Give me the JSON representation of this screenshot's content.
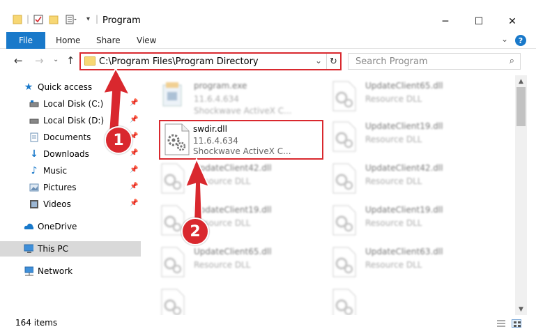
{
  "window": {
    "title": "Program",
    "minimize": "─",
    "maximize": "☐",
    "close": "✕"
  },
  "ribbon": {
    "tabs": [
      "File",
      "Home",
      "Share",
      "View"
    ],
    "help": "?"
  },
  "address": {
    "path": "C:\\Program Files\\Program Directory",
    "search_placeholder": "Search Program"
  },
  "sidebar": {
    "items": [
      {
        "label": "Quick access",
        "icon": "star-icon",
        "pinned": false
      },
      {
        "label": "Local Disk (C:)",
        "icon": "disk-icon",
        "pinned": true
      },
      {
        "label": "Local Disk (D:)",
        "icon": "disk-icon",
        "pinned": true
      },
      {
        "label": "Documents",
        "icon": "documents-icon",
        "pinned": true
      },
      {
        "label": "Downloads",
        "icon": "download-icon",
        "pinned": true
      },
      {
        "label": "Music",
        "icon": "music-icon",
        "pinned": true
      },
      {
        "label": "Pictures",
        "icon": "pictures-icon",
        "pinned": true
      },
      {
        "label": "Videos",
        "icon": "videos-icon",
        "pinned": true
      },
      {
        "label": "OneDrive",
        "icon": "cloud-icon",
        "pinned": false
      },
      {
        "label": "This PC",
        "icon": "computer-icon",
        "pinned": false,
        "selected": true
      },
      {
        "label": "Network",
        "icon": "network-icon",
        "pinned": false
      }
    ]
  },
  "files": [
    {
      "name": "program.exe",
      "line2": "11.6.4.634",
      "line3": "Shockwave ActiveX C...",
      "blurred": true
    },
    {
      "name": "UpdateClient65.dll",
      "line2": "Resource DLL",
      "line3": "",
      "blurred": true
    },
    {
      "name": "swdir.dll",
      "line2": "11.6.4.634",
      "line3": "Shockwave ActiveX C...",
      "blurred": false
    },
    {
      "name": "UpdateClient19.dll",
      "line2": "Resource DLL",
      "line3": "",
      "blurred": true
    },
    {
      "name": "UpdateClient42.dll",
      "line2": "Resource DLL",
      "line3": "",
      "blurred": true
    },
    {
      "name": "UpdateClient42.dll",
      "line2": "Resource DLL",
      "line3": "",
      "blurred": true
    },
    {
      "name": "UpdateClient19.dll",
      "line2": "Resource DLL",
      "line3": "",
      "blurred": true
    },
    {
      "name": "UpdateClient19.dll",
      "line2": "Resource DLL",
      "line3": "",
      "blurred": true
    },
    {
      "name": "UpdateClient65.dll",
      "line2": "Resource DLL",
      "line3": "",
      "blurred": true
    },
    {
      "name": "UpdateClient63.dll",
      "line2": "Resource DLL",
      "line3": "",
      "blurred": true
    },
    {
      "name": "",
      "line2": "",
      "line3": "",
      "blurred": true
    },
    {
      "name": "",
      "line2": "",
      "line3": "",
      "blurred": true
    }
  ],
  "status": {
    "item_count": "164 items"
  },
  "annotations": {
    "step1": "1",
    "step2": "2",
    "color": "#d9282e"
  }
}
